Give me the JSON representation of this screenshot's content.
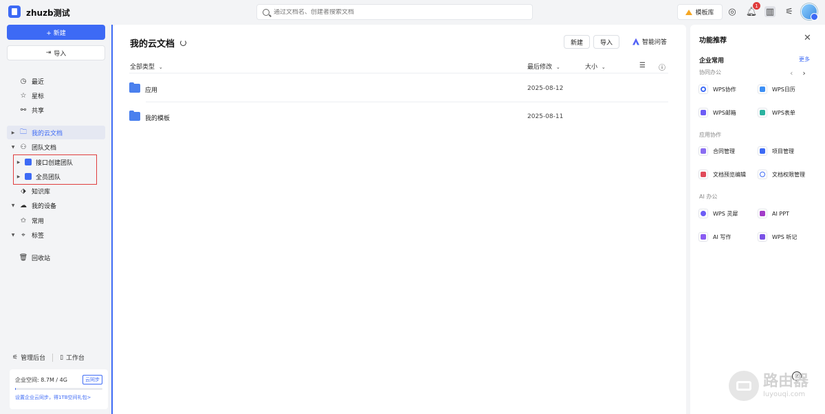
{
  "app": {
    "title": "zhuzb测试"
  },
  "search": {
    "placeholder": "通过文档名、创建者搜索文档"
  },
  "topbar": {
    "template_label": "模板库",
    "notification_count": "1"
  },
  "sidebar": {
    "new_label": "+ 新建",
    "import_label": "导入",
    "items": [
      {
        "label": "最近",
        "icon": "clock-icon"
      },
      {
        "label": "星标",
        "icon": "star-icon"
      },
      {
        "label": "共享",
        "icon": "share-icon"
      },
      {
        "label": "我的云文档",
        "icon": "folder-icon"
      },
      {
        "label": "团队文档",
        "icon": "team-icon"
      },
      {
        "label": "接口创建团队",
        "icon": "team-folder-icon"
      },
      {
        "label": "全员团队",
        "icon": "team-folder-icon"
      },
      {
        "label": "知识库",
        "icon": "knowledge-icon"
      },
      {
        "label": "我的设备",
        "icon": "cloud-device-icon"
      },
      {
        "label": "常用",
        "icon": "pin-icon"
      },
      {
        "label": "标签",
        "icon": "tag-icon"
      },
      {
        "label": "回收站",
        "icon": "trash-icon"
      }
    ],
    "admin_label": "管理后台",
    "workbench_label": "工作台",
    "storage_text": "企业空间: 8.7M / 4G",
    "storage_used": 0.0021,
    "sync_label": "云同步",
    "storage_link": "设置企业云同步，得1TB空间礼包>"
  },
  "main": {
    "title": "我的云文档",
    "new_label": "新建",
    "import_label": "导入",
    "ai_label": "智能问答",
    "col_type": "全部类型",
    "col_modified": "最后修改",
    "col_size": "大小",
    "rows": [
      {
        "name": "应用",
        "date": "2025-08-12"
      },
      {
        "name": "我的模板",
        "date": "2025-08-11"
      }
    ]
  },
  "rpanel": {
    "title": "功能推荐",
    "section_common": "企业常用",
    "more_label": "更多",
    "sub_collab": "协同办公",
    "collab": [
      {
        "label": "WPS协作",
        "color": "#3d6af5"
      },
      {
        "label": "WPS日历",
        "color": "#3d8ff5"
      },
      {
        "label": "WPS邮箱",
        "color": "#6d5df6"
      },
      {
        "label": "WPS表单",
        "color": "#2bb3a0"
      }
    ],
    "sub_app": "应用协作",
    "app": [
      {
        "label": "合同管理",
        "color": "#8a6df2"
      },
      {
        "label": "项目管理",
        "color": "#3d6af5"
      },
      {
        "label": "文档预览编辑",
        "color": "#e04a5a"
      },
      {
        "label": "文档权限管理",
        "color": "#3d6af5"
      }
    ],
    "sub_ai": "AI 办公",
    "ai": [
      {
        "label": "WPS 灵犀",
        "color": "#6d5df6"
      },
      {
        "label": "AI PPT",
        "color": "#a23cc8"
      },
      {
        "label": "AI 写作",
        "color": "#8a5cf2"
      },
      {
        "label": "WPS 听记",
        "color": "#7a52e6"
      }
    ]
  },
  "watermark": {
    "cn": "路由器",
    "en": "luyouqi.com"
  }
}
